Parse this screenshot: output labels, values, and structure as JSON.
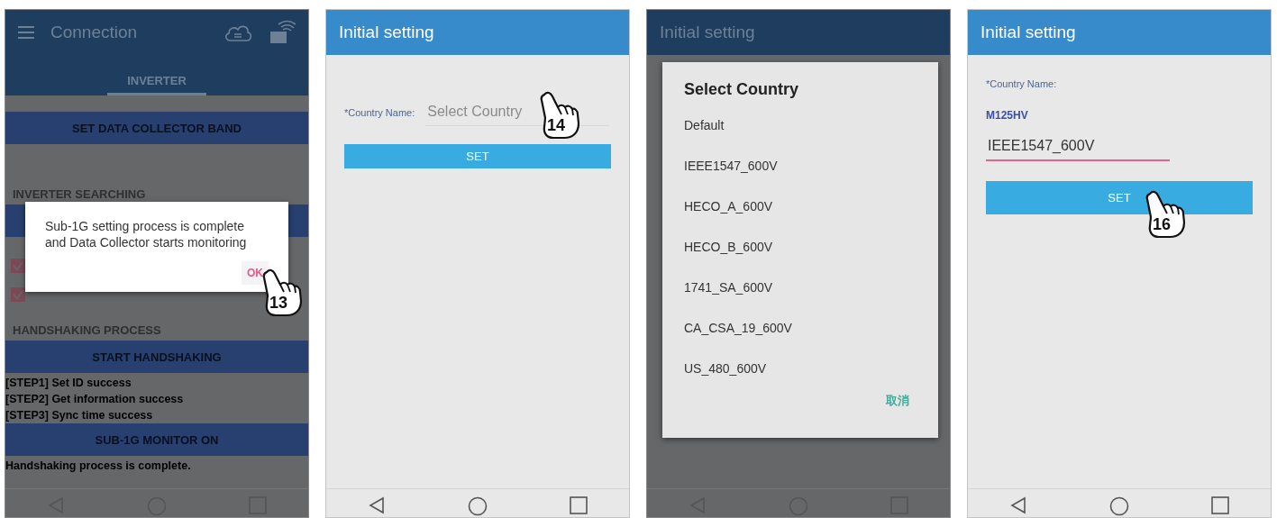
{
  "panels": [
    {
      "kind": "connection",
      "dimmed": true,
      "title": "Connection",
      "tabs": [
        {
          "label": "INVERTER",
          "selected": true
        }
      ],
      "content": [
        {
          "kind": "button",
          "label": "SET DATA COLLECTOR BAND"
        },
        {
          "kind": "heading",
          "text": "INVERTER SEARCHING"
        },
        {
          "kind": "button"
        },
        {
          "kind": "checkbox",
          "checked": true
        },
        {
          "kind": "checkbox",
          "checked": true
        },
        {
          "kind": "heading",
          "text": "HANDSHAKING PROCESS"
        },
        {
          "kind": "button",
          "label": "START HANDSHAKING"
        },
        {
          "kind": "log",
          "text": "[STEP1] Set ID success"
        },
        {
          "kind": "log",
          "text": "[STEP2] Get information success"
        },
        {
          "kind": "log",
          "text": "[STEP3] Sync time success"
        },
        {
          "kind": "button",
          "label": "SUB-1G MONITOR ON"
        },
        {
          "kind": "log",
          "text": "Handshaking process is complete."
        }
      ],
      "dialog": {
        "message": "Sub-1G setting process is complete and Data Collector starts monitoring",
        "button": "OK"
      },
      "callout": "13"
    },
    {
      "kind": "form-inline",
      "dimmed": false,
      "title": "Initial setting",
      "label": "*Country Name:",
      "field": {
        "placeholder": "Select Country",
        "focused": false
      },
      "button": "SET",
      "callout": "14"
    },
    {
      "kind": "picker",
      "dimmed": true,
      "title": "Initial setting",
      "dialog": {
        "title": "Select Country",
        "options": [
          "Default",
          "IEEE1547_600V",
          "HECO_A_600V",
          "HECO_B_600V",
          "1741_SA_600V",
          "CA_CSA_19_600V",
          "US_480_600V"
        ],
        "cancel": "取消"
      }
    },
    {
      "kind": "form-stacked",
      "dimmed": false,
      "title": "Initial setting",
      "label": "*Country Name:",
      "model": "M125HV",
      "field": {
        "value": "IEEE1547_600V",
        "focused": true
      },
      "button": "SET",
      "callout": "16"
    }
  ]
}
